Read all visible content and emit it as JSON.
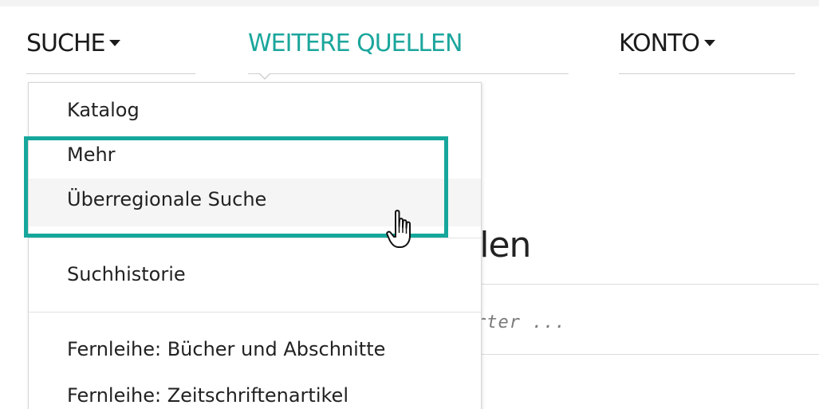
{
  "nav": {
    "suche": "SUCHE",
    "weitere_quellen": "WEITERE QUELLEN",
    "konto": "KONTO"
  },
  "dropdown": {
    "items": {
      "katalog": "Katalog",
      "mehr": "Mehr",
      "ueberregionale_suche": "Überregionale Suche",
      "suchhistorie": "Suchhistorie",
      "fernleihe_buecher": "Fernleihe: Bücher und Abschnitte",
      "fernleihe_zeitschriften": "Fernleihe: Zeitschriftenartikel"
    }
  },
  "background": {
    "heading_fragment": "llen",
    "placeholder_fragment": "rter ..."
  },
  "colors": {
    "accent": "#1ba69c",
    "highlight_border": "#16a79c",
    "text": "#1b1b1b",
    "hover_bg": "#f5f5f5"
  },
  "icons": {
    "caret": "caret-down-icon",
    "cursor": "hand-pointer-icon"
  }
}
